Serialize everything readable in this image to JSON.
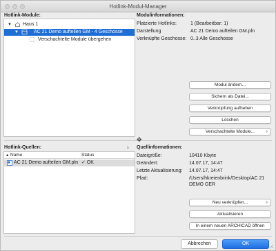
{
  "window": {
    "title": "Hotlink-Modul-Manager"
  },
  "modules_panel": {
    "label": "Hotlink-Module:",
    "tree": [
      {
        "label": "Haus 1",
        "expanded": true
      },
      {
        "label": "AC 21 Demo aufteilen GM - 4 Geschosse",
        "expanded": true,
        "selected": true
      },
      {
        "label": "Verschachtelte Module übergehen"
      }
    ]
  },
  "module_info": {
    "label": "Modulinformationen:",
    "rows": [
      {
        "key": "Platzierte Hotlinks:",
        "value": "1 (Bearbeitbar: 1)"
      },
      {
        "key": "Darstellung",
        "value": "AC 21 Demo aufteilen GM.pln"
      },
      {
        "key": "Verknüpfte Geschosse:",
        "value": "0..3 Alle Geschosse"
      }
    ],
    "buttons": {
      "change": "Modul ändern...",
      "save_as": "Sichern als Datei...",
      "unlink": "Verknüpfung aufheben",
      "delete": "Löschen",
      "nested": "Verschachtelte Module..."
    }
  },
  "sources_panel": {
    "label": "Hotlink-Quellen:",
    "columns": {
      "name": "Name",
      "status": "Status"
    },
    "rows": [
      {
        "name": "AC 21 Demo aufteilen GM.pln",
        "status": "✓ OK"
      }
    ]
  },
  "source_info": {
    "label": "Quellinformationen:",
    "rows": [
      {
        "key": "Dateigröße:",
        "value": "10410 Kbyte"
      },
      {
        "key": "Geändert:",
        "value": "14.07.17, 14:47"
      },
      {
        "key": "Letzte Aktualisierung:",
        "value": "14.07.17, 14:47"
      },
      {
        "key": "Pfad:",
        "value": "/Users/hkreienbrink/Desktop/AC 21",
        "value2": "DEMO GER"
      }
    ],
    "buttons": {
      "relink": "Neu verknüpfen...",
      "update": "Aktualisieren",
      "open": "In einem neuen ARCHICAD öffnen"
    }
  },
  "footer": {
    "cancel": "Abbrechen",
    "ok": "OK"
  },
  "colors": {
    "accent": "#1f6ed6",
    "ok_button": "#2a78e8"
  }
}
